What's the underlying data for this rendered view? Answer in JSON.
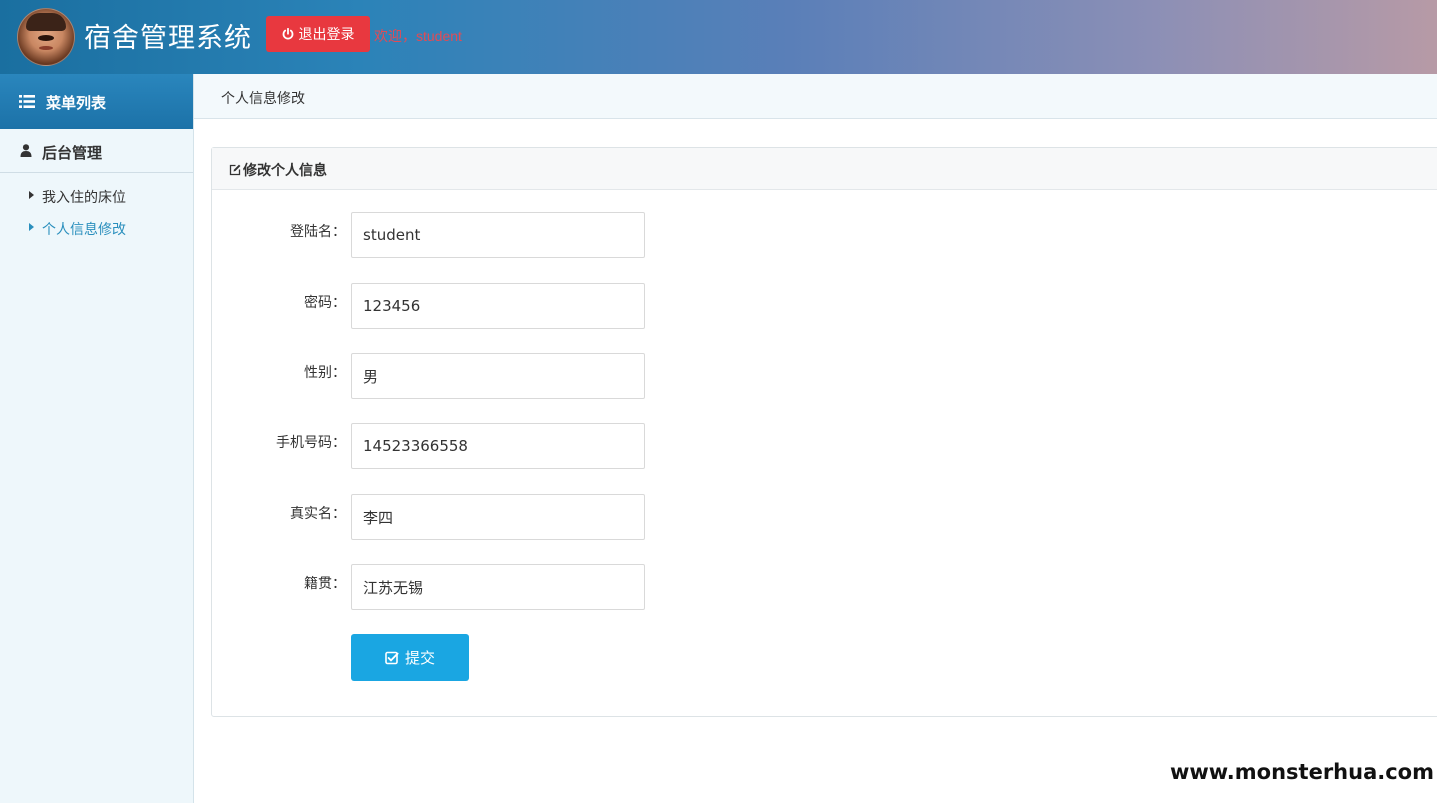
{
  "header": {
    "app_title": "宿舍管理系统",
    "logout_label": "退出登录",
    "welcome_text": "欢迎，student"
  },
  "sidebar": {
    "menu_header": "菜单列表",
    "section_label": "后台管理",
    "items": [
      {
        "label": "我入住的床位",
        "active": false
      },
      {
        "label": "个人信息修改",
        "active": true
      }
    ]
  },
  "breadcrumb": "个人信息修改",
  "panel": {
    "title": "修改个人信息"
  },
  "form": {
    "fields": [
      {
        "label": "登陆名：",
        "value": "student"
      },
      {
        "label": "密码：",
        "value": "123456"
      },
      {
        "label": "性别：",
        "value": "男"
      },
      {
        "label": "手机号码：",
        "value": "14523366558"
      },
      {
        "label": "真实名：",
        "value": "李四"
      },
      {
        "label": "籍贯：",
        "value": "江苏无锡"
      }
    ],
    "submit_label": "提交"
  },
  "watermark": "www.monsterhua.com",
  "colors": {
    "logout": "#e8383f",
    "submit": "#1aa6e2",
    "active_nav": "#2a8fbd",
    "welcome": "#e24b55"
  }
}
